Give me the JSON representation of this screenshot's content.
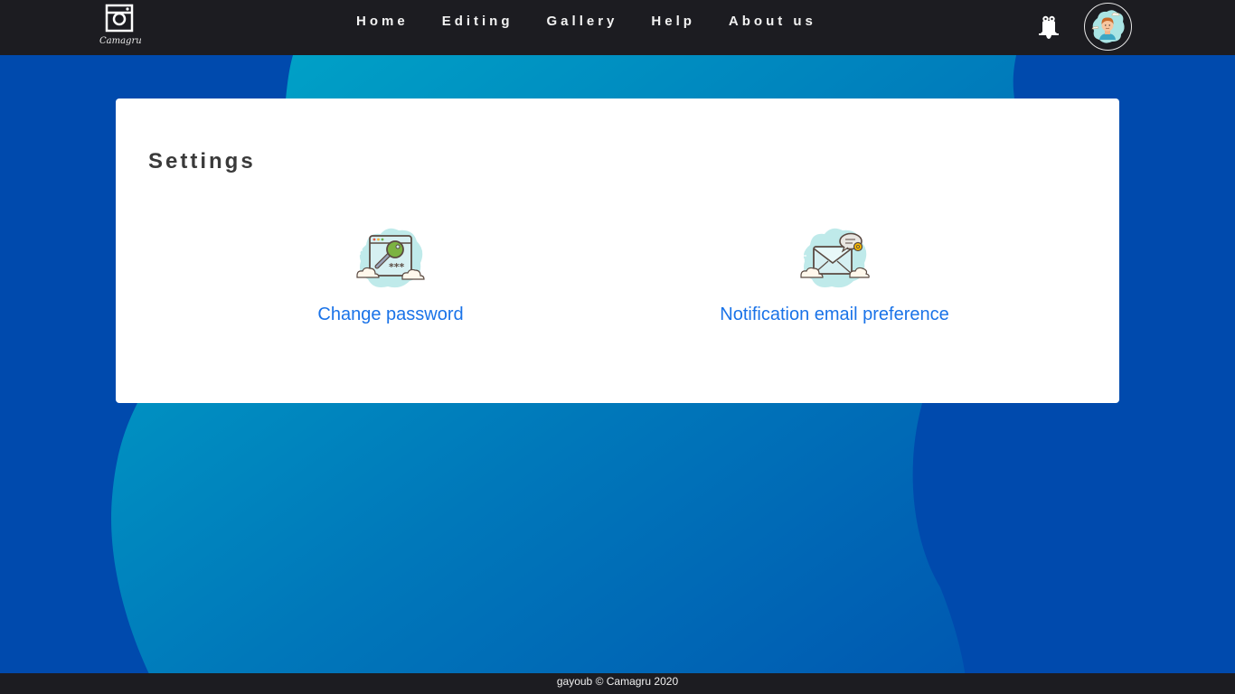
{
  "header": {
    "logo_text": "Camagru",
    "nav": [
      {
        "label": "Home"
      },
      {
        "label": "Editing"
      },
      {
        "label": "Gallery"
      },
      {
        "label": "Help"
      },
      {
        "label": "About us"
      }
    ],
    "icons": {
      "logo": "camera-icon",
      "notifications": "bell-icon",
      "profile": "avatar"
    }
  },
  "settings": {
    "title": "Settings",
    "options": [
      {
        "label": "Change password",
        "icon": "password-key-icon"
      },
      {
        "label": "Notification email preference",
        "icon": "email-notification-icon"
      }
    ]
  },
  "footer": {
    "text": "gayoub © Camagru 2020"
  },
  "colors": {
    "navbar": "#1c1c21",
    "background": "#004aad",
    "wave_light": "#00a6c8",
    "link": "#1a73e8",
    "card": "#ffffff"
  }
}
